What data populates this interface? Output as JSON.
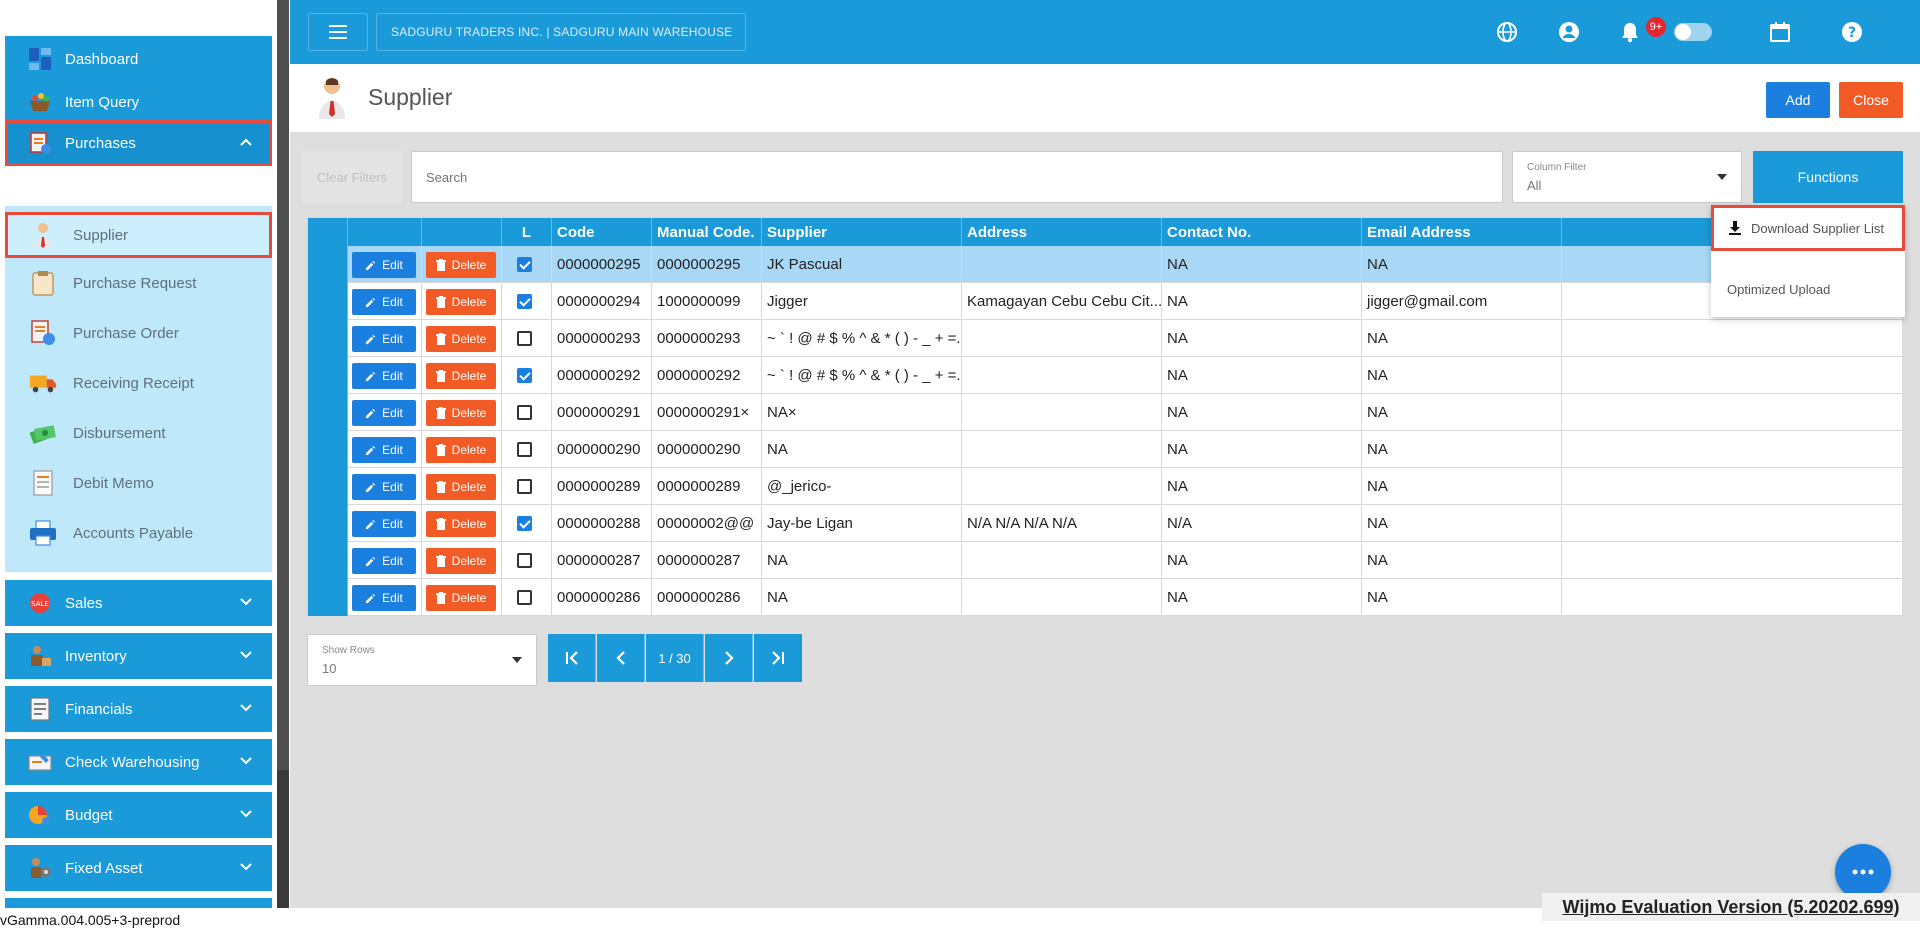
{
  "sidebar": {
    "items": [
      {
        "label": "Dashboard"
      },
      {
        "label": "Item Query"
      },
      {
        "label": "Purchases"
      },
      {
        "label": "Sales"
      },
      {
        "label": "Inventory"
      },
      {
        "label": "Financials"
      },
      {
        "label": "Check Warehousing"
      },
      {
        "label": "Budget"
      },
      {
        "label": "Fixed Asset"
      }
    ],
    "purchases_sub": [
      {
        "label": "Supplier"
      },
      {
        "label": "Purchase Request"
      },
      {
        "label": "Purchase Order"
      },
      {
        "label": "Receiving Receipt"
      },
      {
        "label": "Disbursement"
      },
      {
        "label": "Debit Memo"
      },
      {
        "label": "Accounts Payable"
      }
    ]
  },
  "topbar": {
    "company": "SADGURU TRADERS INC. | SADGURU MAIN WAREHOUSE",
    "notification_count": "9+"
  },
  "page": {
    "title": "Supplier",
    "add_label": "Add",
    "close_label": "Close"
  },
  "filters": {
    "clear_label": "Clear Filters",
    "search_placeholder": "Search",
    "column_filter_label": "Column Filter",
    "column_filter_value": "All",
    "functions_label": "Functions"
  },
  "functions_menu": {
    "download_label": "Download Supplier List",
    "upload_label": "Optimized Upload"
  },
  "grid": {
    "headers": [
      "L",
      "Code",
      "Manual Code.",
      "Supplier",
      "Address",
      "Contact No.",
      "Email Address"
    ],
    "edit_label": "Edit",
    "delete_label": "Delete",
    "rows": [
      {
        "checked": true,
        "code": "0000000295",
        "manual": "0000000295",
        "supplier": "JK Pascual",
        "address": "",
        "contact": "NA",
        "email": "NA"
      },
      {
        "checked": true,
        "code": "0000000294",
        "manual": "1000000099",
        "supplier": "Jigger",
        "address": "Kamagayan Cebu Cebu Cit...",
        "contact": "NA",
        "email": "jigger@gmail.com"
      },
      {
        "checked": false,
        "code": "0000000293",
        "manual": "0000000293",
        "supplier": "~ ` ! @ # $ % ^ & * ( ) - _ + =...",
        "address": "",
        "contact": "NA",
        "email": "NA"
      },
      {
        "checked": true,
        "code": "0000000292",
        "manual": "0000000292",
        "supplier": "~ ` ! @ # $ % ^ & * ( ) - _ + =...",
        "address": "",
        "contact": "NA",
        "email": "NA"
      },
      {
        "checked": false,
        "code": "0000000291",
        "manual": "0000000291×",
        "supplier": "NA×",
        "address": "",
        "contact": "NA",
        "email": "NA"
      },
      {
        "checked": false,
        "code": "0000000290",
        "manual": "0000000290",
        "supplier": "NA",
        "address": "",
        "contact": "NA",
        "email": "NA"
      },
      {
        "checked": false,
        "code": "0000000289",
        "manual": "0000000289",
        "supplier": "@_jerico-",
        "address": "",
        "contact": "NA",
        "email": "NA"
      },
      {
        "checked": true,
        "code": "0000000288",
        "manual": "00000002@@",
        "supplier": "Jay-be Ligan",
        "address": "N/A N/A N/A N/A",
        "contact": "N/A",
        "email": "NA"
      },
      {
        "checked": false,
        "code": "0000000287",
        "manual": "0000000287",
        "supplier": "NA",
        "address": "",
        "contact": "NA",
        "email": "NA"
      },
      {
        "checked": false,
        "code": "0000000286",
        "manual": "0000000286",
        "supplier": "NA",
        "address": "",
        "contact": "NA",
        "email": "NA"
      }
    ]
  },
  "pagination": {
    "show_rows_label": "Show Rows",
    "show_rows_value": "10",
    "page_indicator": "1 / 30"
  },
  "footer": {
    "version": "vGamma.004.005+3-preprod",
    "wijmo": "Wijmo Evaluation Version (5.20202.699)"
  },
  "colors": {
    "primary": "#1b9ad9",
    "add": "#1b7fe0",
    "danger": "#f25b26",
    "highlight": "#e84b3c"
  }
}
